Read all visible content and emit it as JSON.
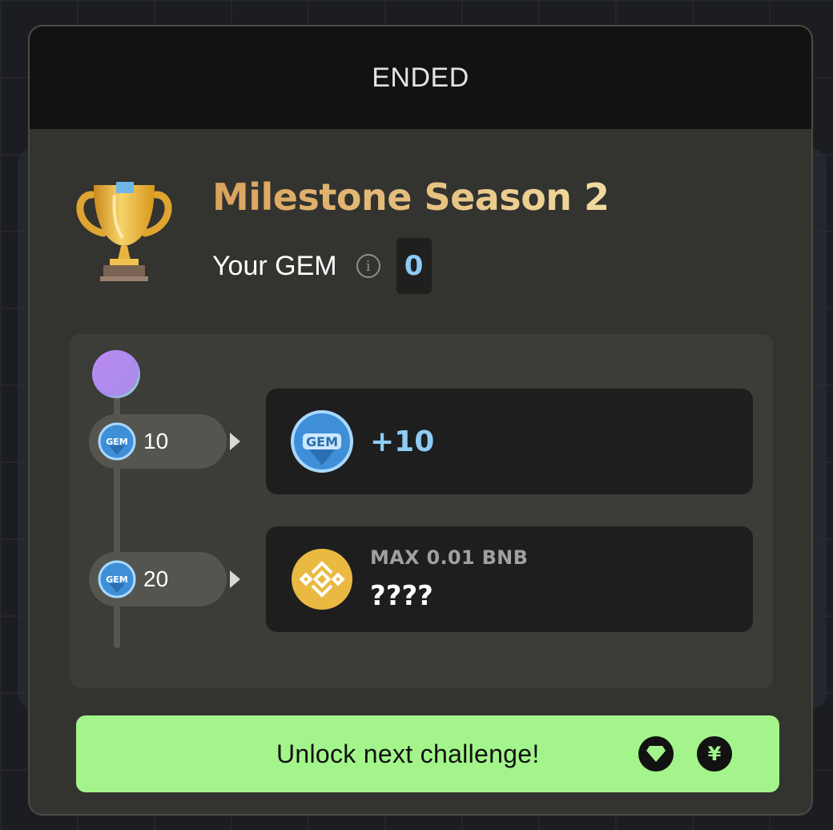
{
  "header": {
    "status": "ENDED"
  },
  "season": {
    "title": "Milestone Season 2",
    "gem_label": "Your GEM",
    "info_glyph": "i",
    "gem_value": "0"
  },
  "milestones": [
    {
      "threshold": "10",
      "reward_amount": "+10",
      "reward_icon": "gem-icon"
    },
    {
      "threshold": "20",
      "reward_cap": "MAX 0.01 BNB",
      "reward_mystery": "????",
      "reward_icon": "bnb-icon"
    }
  ],
  "footer": {
    "unlock_label": "Unlock next challenge!",
    "icon_1": "diamond-icon",
    "icon_2": "yuan-icon",
    "icon_2_glyph": "¥"
  },
  "colors": {
    "accent_green": "#a3f58b",
    "gem_blue": "#8ecbf5",
    "title_gold": "#d9a25a",
    "bnb_yellow": "#e9b941"
  }
}
